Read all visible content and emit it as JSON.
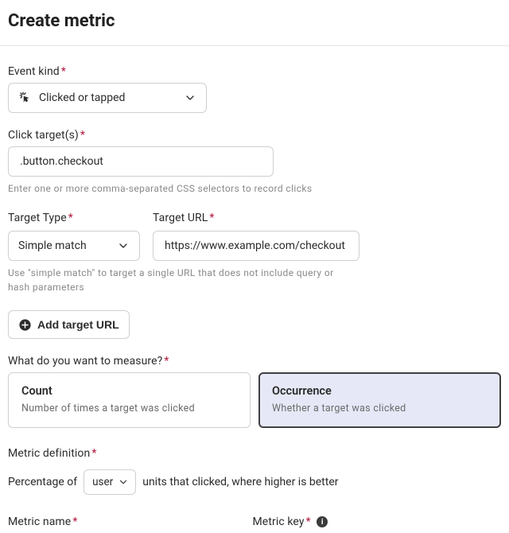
{
  "title": "Create metric",
  "event_kind": {
    "label": "Event kind",
    "value": "Clicked or tapped"
  },
  "click_targets": {
    "label": "Click target(s)",
    "value": ".button.checkout",
    "helper": "Enter one or more comma-separated CSS selectors to record clicks"
  },
  "target_type": {
    "label": "Target Type",
    "value": "Simple match",
    "helper": "Use \"simple match\" to target a single URL that does not include query or hash parameters"
  },
  "target_url": {
    "label": "Target URL",
    "value": "https://www.example.com/checkout"
  },
  "add_target_btn": "Add target URL",
  "measure": {
    "label": "What do you want to measure?",
    "options": [
      {
        "title": "Count",
        "desc": "Number of times a target was clicked",
        "selected": false
      },
      {
        "title": "Occurrence",
        "desc": "Whether a target was clicked",
        "selected": true
      }
    ]
  },
  "definition": {
    "label": "Metric definition",
    "prefix": "Percentage of",
    "unit": "user",
    "suffix": "units that clicked, where higher is better"
  },
  "metric_name_label": "Metric name",
  "metric_key_label": "Metric key"
}
